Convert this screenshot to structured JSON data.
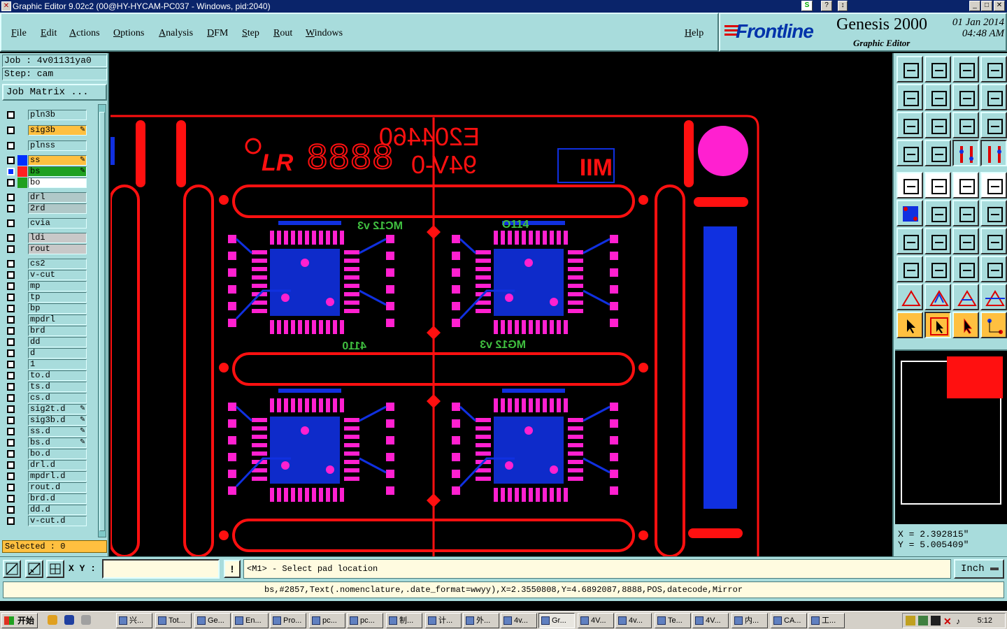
{
  "window": {
    "title": "Graphic Editor 9.02c2 (00@HY-HYCAM-PC037 - Windows, pid:2040)"
  },
  "menu": [
    "File",
    "Edit",
    "Actions",
    "Options",
    "Analysis",
    "DFM",
    "Step",
    "Rout",
    "Windows"
  ],
  "help_label": "Help",
  "brand": {
    "logo": "Frontline",
    "product": "Genesis 2000",
    "subtitle": "Graphic Editor",
    "date": "01 Jan 2014",
    "time": "04:48 AM"
  },
  "job": {
    "job_line": "Job : 4v01131ya0",
    "step_line": "Step: cam",
    "matrix_button": "Job Matrix ..."
  },
  "layers": [
    {
      "name": "pln3b",
      "color": "",
      "edit": false
    },
    {
      "name": "sig3b",
      "color": "#ffc040",
      "edit": true
    },
    {
      "name": "plnss",
      "color": "",
      "edit": false
    },
    {
      "name": "ss",
      "color": "#ffc040",
      "edit": true,
      "swatch": "#0030ff"
    },
    {
      "name": "bs",
      "color": "#20a020",
      "edit": true,
      "swatch": "#ff2020",
      "active": true
    },
    {
      "name": "bo",
      "color": "#ffffff",
      "edit": false,
      "swatch": "#20a020"
    },
    {
      "name": "drl",
      "color": "#b0c8c8",
      "edit": false
    },
    {
      "name": "2rd",
      "color": "#b0c8c8",
      "edit": false
    },
    {
      "name": "cvia",
      "color": "",
      "edit": false
    },
    {
      "name": "ldi",
      "color": "#c8c8c8",
      "edit": false
    },
    {
      "name": "rout",
      "color": "#c8c8c8",
      "edit": false
    },
    {
      "name": "cs2",
      "color": "",
      "edit": false
    },
    {
      "name": "v-cut",
      "color": "",
      "edit": false
    },
    {
      "name": "mp",
      "color": "",
      "edit": false
    },
    {
      "name": "tp",
      "color": "",
      "edit": false
    },
    {
      "name": "bp",
      "color": "",
      "edit": false
    },
    {
      "name": "mpdrl",
      "color": "",
      "edit": false
    },
    {
      "name": "brd",
      "color": "",
      "edit": false
    },
    {
      "name": "dd",
      "color": "",
      "edit": false
    },
    {
      "name": "d",
      "color": "",
      "edit": false
    },
    {
      "name": "1",
      "color": "",
      "edit": false
    },
    {
      "name": "to.d",
      "color": "",
      "edit": false
    },
    {
      "name": "ts.d",
      "color": "",
      "edit": false
    },
    {
      "name": "cs.d",
      "color": "",
      "edit": false
    },
    {
      "name": "sig2t.d",
      "color": "",
      "edit": true
    },
    {
      "name": "sig3b.d",
      "color": "",
      "edit": true
    },
    {
      "name": "ss.d",
      "color": "",
      "edit": true
    },
    {
      "name": "bs.d",
      "color": "",
      "edit": true
    },
    {
      "name": "bo.d",
      "color": "",
      "edit": false
    },
    {
      "name": "drl.d",
      "color": "",
      "edit": false
    },
    {
      "name": "mpdrl.d",
      "color": "",
      "edit": false
    },
    {
      "name": "rout.d",
      "color": "",
      "edit": false
    },
    {
      "name": "brd.d",
      "color": "",
      "edit": false
    },
    {
      "name": "dd.d",
      "color": "",
      "edit": false
    },
    {
      "name": "v-cut.d",
      "color": "",
      "edit": false
    }
  ],
  "selected_label": "Selected : 0",
  "canvas": {
    "marking_code": "E204460",
    "rating": "94V-0",
    "rating_box": "MII",
    "datecode": "8888",
    "logo_text": "LR",
    "chip_labels_top": [
      "MC12 v3",
      "O114"
    ],
    "chip_labels_bottom": [
      "4110",
      "MG12 v3"
    ]
  },
  "coords": {
    "x": "X = 2.392815\"",
    "y": "Y = 5.005409\""
  },
  "command": {
    "xy_label": "X Y :",
    "xy_value": "",
    "warn_label": "!",
    "prompt": "<M1> - Select pad location",
    "units": "Inch"
  },
  "status_line": "bs,#2857,Text(.nomenclature,.date_format=wwyy),X=2.3550808,Y=4.6892087,8888,POS,datecode,Mirror",
  "taskbar": {
    "start": "开始",
    "tasks": [
      "兴...",
      "Tot...",
      "Ge...",
      "En...",
      "Pro...",
      "pc...",
      "pc...",
      "制...",
      "计...",
      "外...",
      "4v...",
      "Gr...",
      "4V...",
      "4v...",
      "Te...",
      "4V...",
      "内...",
      "CA...",
      "工..."
    ],
    "clock": "5:12"
  },
  "colors": {
    "panel": "#a8dcdc",
    "pcb_red": "#ff1010",
    "pcb_blue": "#1030e0",
    "pcb_magenta": "#ff20d0",
    "pcb_green": "#40c040"
  }
}
